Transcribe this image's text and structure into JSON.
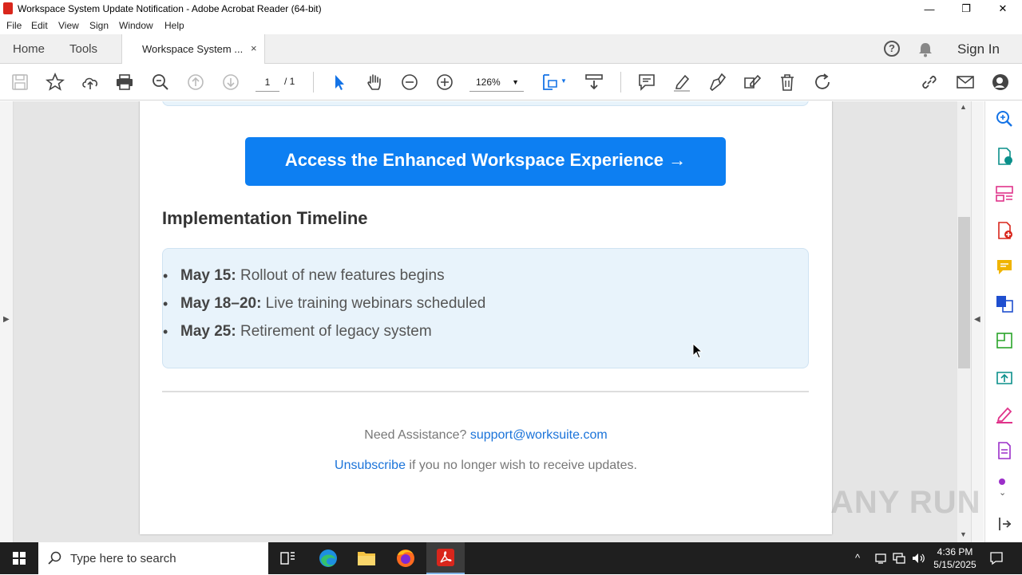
{
  "window": {
    "title": "Workspace System Update Notification - Adobe Acrobat Reader (64-bit)",
    "minimize": "—",
    "restore": "❐",
    "close": "✕"
  },
  "menu": [
    "File",
    "Edit",
    "View",
    "Sign",
    "Window",
    "Help"
  ],
  "tabs": {
    "home": "Home",
    "tools": "Tools",
    "document": "Workspace System ...",
    "close": "×",
    "sign_in": "Sign In"
  },
  "toolbar": {
    "page_current": "1",
    "page_total": "/ 1",
    "zoom": "126%"
  },
  "document": {
    "cta_button": "Access the Enhanced Workspace Experience →",
    "timeline_title": "Implementation Timeline",
    "timeline": [
      {
        "date": "May 15:",
        "text": " Rollout of new features begins"
      },
      {
        "date": "May 18–20:",
        "text": " Live training webinars scheduled"
      },
      {
        "date": "May 25:",
        "text": " Retirement of legacy system"
      }
    ],
    "assist_text": "Need Assistance? ",
    "assist_email": "support@worksuite.com",
    "unsubscribe_link": "Unsubscribe",
    "unsubscribe_text": " if you no longer wish to receive updates."
  },
  "watermark": "ANY RUN",
  "taskbar": {
    "search_placeholder": "Type here to search",
    "time": "4:36 PM",
    "date": "5/15/2025"
  },
  "colors": {
    "accent_blue": "#0d7ff2",
    "pdf_red": "#d9261c",
    "tool_pink": "#e0338a",
    "tool_teal": "#0a8f8a"
  }
}
